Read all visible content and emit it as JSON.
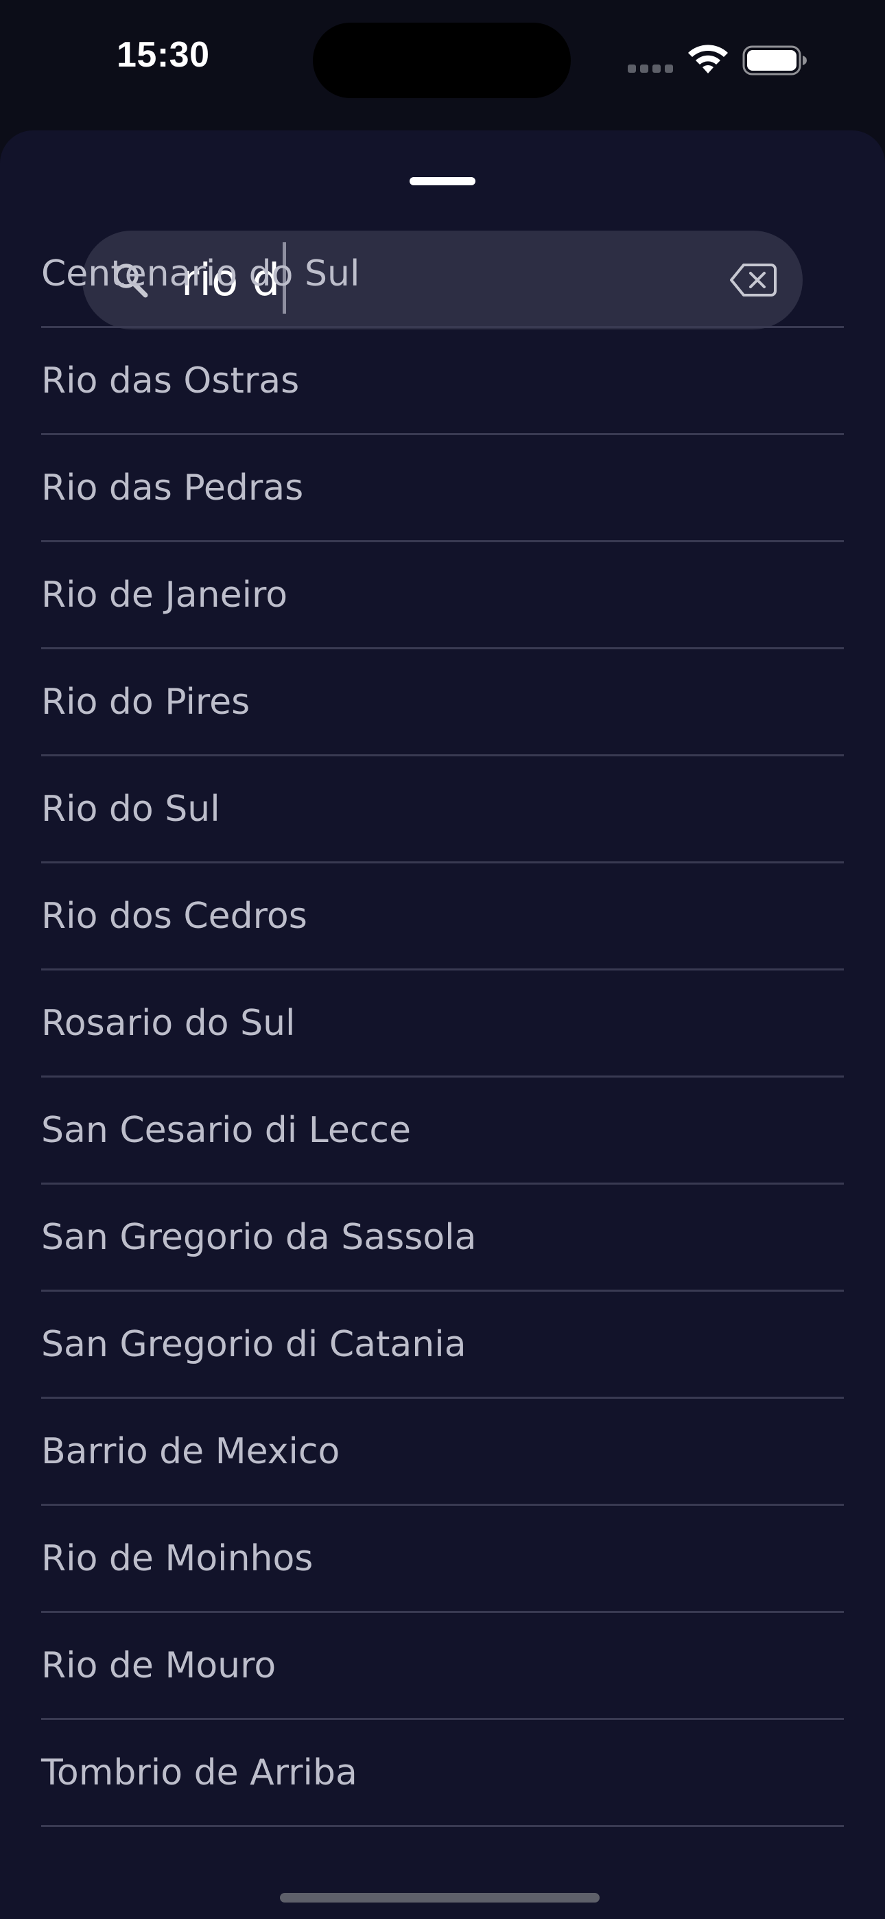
{
  "status_bar": {
    "time": "15:30",
    "icons": [
      "cellular-signal-icon",
      "wifi-icon",
      "battery-icon"
    ]
  },
  "search": {
    "query": "rio d",
    "icons": [
      "search-icon",
      "clear-backspace-icon"
    ]
  },
  "results": [
    "Centenario do Sul",
    "Rio das Ostras",
    "Rio das Pedras",
    "Rio de Janeiro",
    "Rio do Pires",
    "Rio do Sul",
    "Rio dos Cedros",
    "Rosario do Sul",
    "San Cesario di Lecce",
    "San Gregorio da Sassola",
    "San Gregorio di Catania",
    "Barrio de Mexico",
    "Rio de Moinhos",
    "Rio de Mouro",
    "Tombrio de Arriba"
  ],
  "colors": {
    "background": "#0c0d18",
    "sheet": "#12132a",
    "search_field": "#2d2e44",
    "item_text": "#bdbecb",
    "divider": "#393a52"
  }
}
